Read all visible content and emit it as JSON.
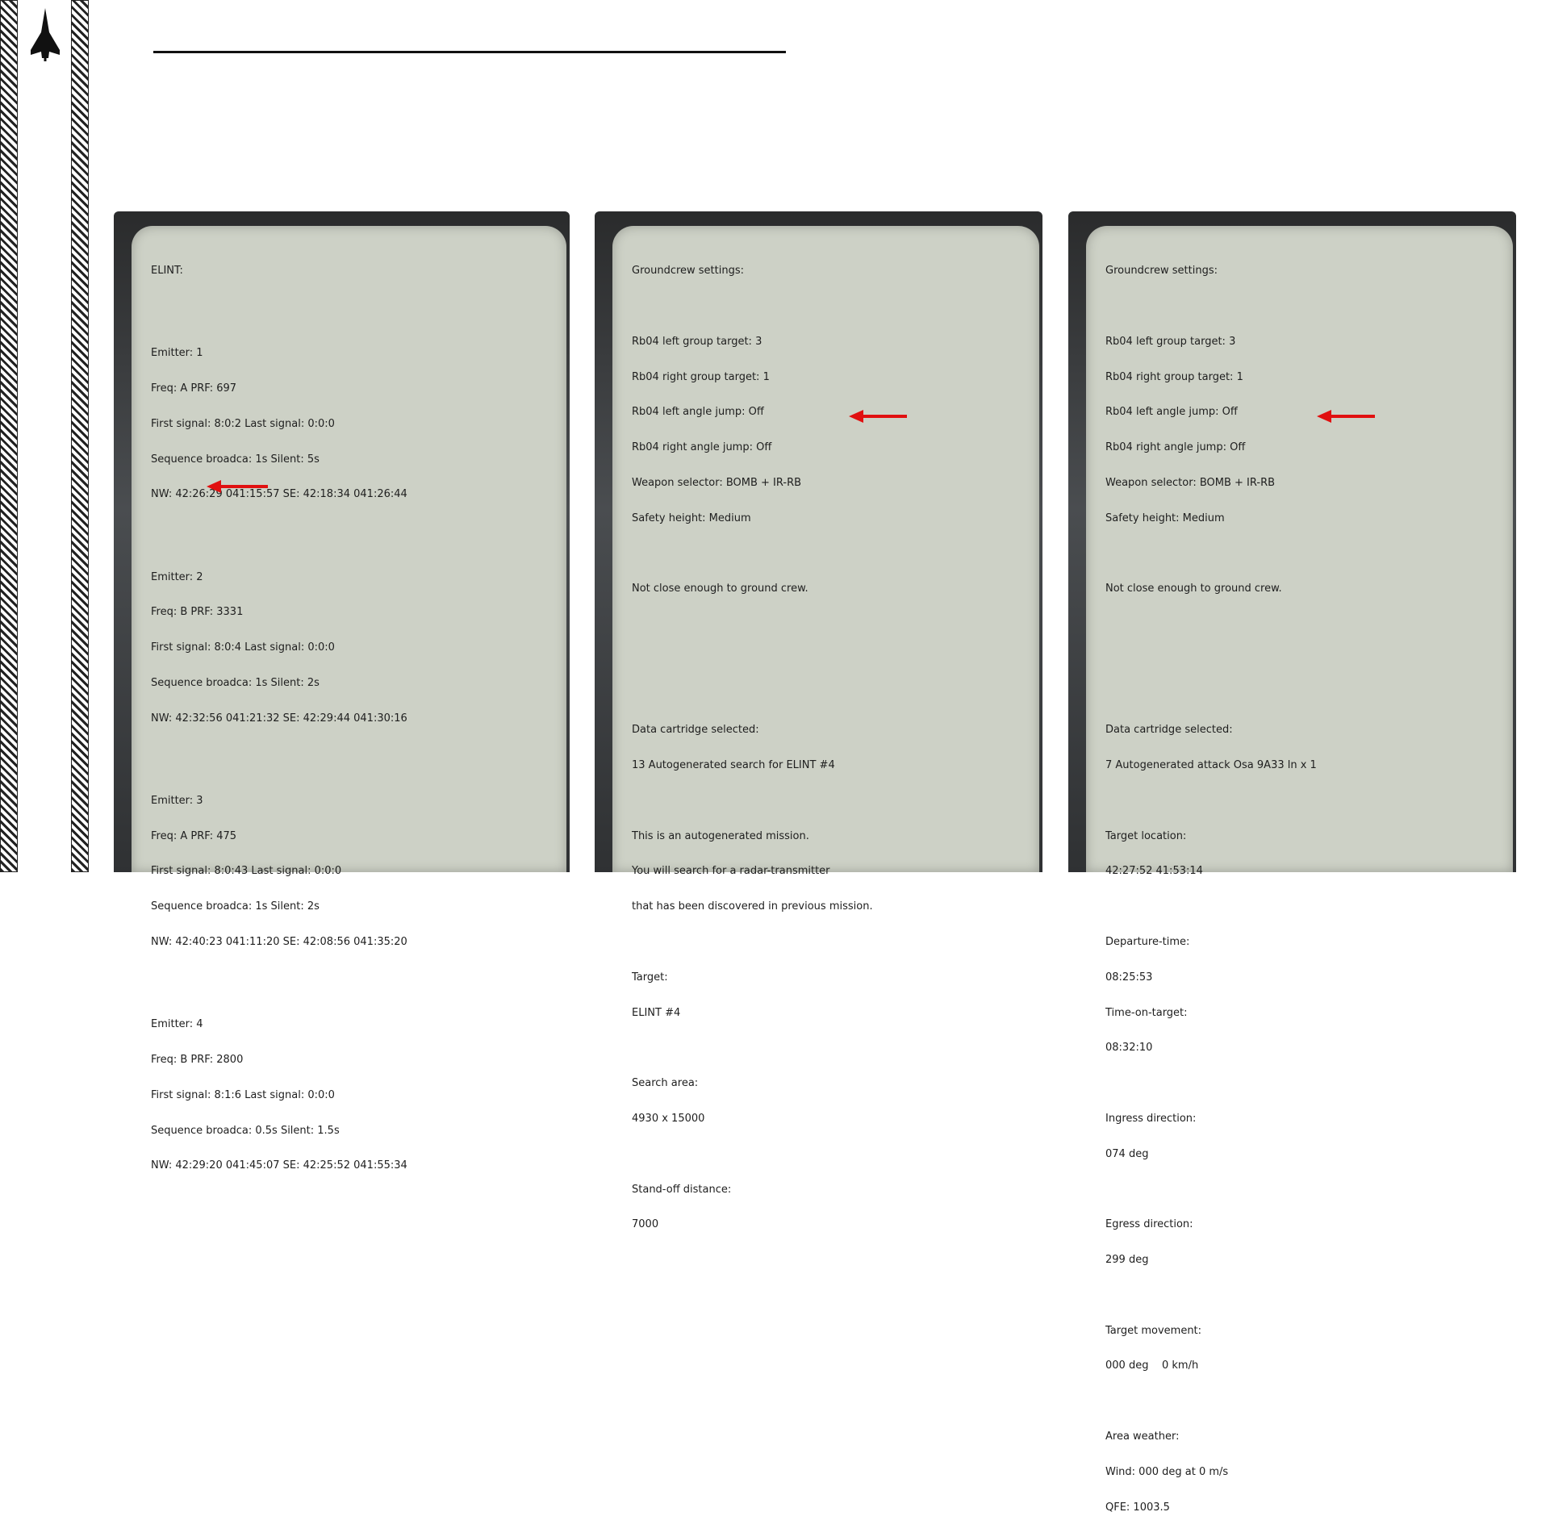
{
  "slide": {
    "title": ""
  },
  "colors": {
    "paper": "#cdd1c6",
    "arrow": "#e11010",
    "text": "#1e1e1e"
  },
  "icons": {
    "logo": "jet-silhouette-icon",
    "pointer": "red-arrow-icon"
  },
  "elint": {
    "heading": "ELINT:",
    "emitters": [
      {
        "label": "Emitter: 1",
        "freq": "Freq: A PRF: 697",
        "signal": "First signal: 8:0:2 Last signal: 0:0:0",
        "sequence": "Sequence broadca: 1s Silent: 5s",
        "coords": "NW: 42:26:29 041:15:57 SE: 42:18:34 041:26:44"
      },
      {
        "label": "Emitter: 2",
        "freq": "Freq: B PRF: 3331",
        "signal": "First signal: 8:0:4 Last signal: 0:0:0",
        "sequence": "Sequence broadca: 1s Silent: 2s",
        "coords": "NW: 42:32:56 041:21:32 SE: 42:29:44 041:30:16"
      },
      {
        "label": "Emitter: 3",
        "freq": "Freq: A PRF: 475",
        "signal": "First signal: 8:0:43 Last signal: 0:0:0",
        "sequence": "Sequence broadca: 1s Silent: 2s",
        "coords": "NW: 42:40:23 041:11:20 SE: 42:08:56 041:35:20"
      },
      {
        "label": "Emitter: 4",
        "freq": "Freq: B PRF: 2800",
        "signal": "First signal: 8:1:6 Last signal: 0:0:0",
        "sequence": "Sequence broadca: 0.5s Silent: 1.5s",
        "coords": "NW: 42:29:20 041:45:07 SE: 42:25:52 041:55:34"
      }
    ]
  },
  "groundcrew_search": {
    "heading": "Groundcrew settings:",
    "settings": [
      "Rb04 left group target: 3",
      "Rb04 right group target: 1",
      "Rb04 left angle jump: Off",
      "Rb04 right angle jump: Off",
      "Weapon selector: BOMB + IR-RB",
      "Safety height: Medium"
    ],
    "status": "Not close enough to ground crew.",
    "cartridge_label": "Data cartridge selected:",
    "cartridge_value": "13 Autogenerated search for ELINT #4",
    "description": [
      "This is an autogenerated mission.",
      "You will search for a radar-transmitter",
      "that has been discovered in previous mission."
    ],
    "target_label": "Target:",
    "target_value": "ELINT #4",
    "area_label": "Search area:",
    "area_value": "4930 x 15000",
    "standoff_label": "Stand-off distance:",
    "standoff_value": "7000"
  },
  "groundcrew_attack": {
    "heading": "Groundcrew settings:",
    "settings": [
      "Rb04 left group target: 3",
      "Rb04 right group target: 1",
      "Rb04 left angle jump: Off",
      "Rb04 right angle jump: Off",
      "Weapon selector: BOMB + IR-RB",
      "Safety height: Medium"
    ],
    "status": "Not close enough to ground crew.",
    "cartridge_label": "Data cartridge selected:",
    "cartridge_value": "7 Autogenerated attack Osa 9A33 ln x 1",
    "location_label": "Target location:",
    "location_value": "42:27:52 41:53:14",
    "departure_label": "Departure-time:",
    "departure_value": "08:25:53",
    "tot_label": "Time-on-target:",
    "tot_value": "08:32:10",
    "ingress_label": "Ingress direction:",
    "ingress_value": "074 deg",
    "egress_label": "Egress direction:",
    "egress_value": "299 deg",
    "movement_label": "Target movement:",
    "movement_value": "000 deg    0 km/h",
    "weather_label": "Area weather:",
    "wind_value": "Wind: 000 deg at 0 m/s",
    "qfe_value": "QFE: 1003.5"
  }
}
